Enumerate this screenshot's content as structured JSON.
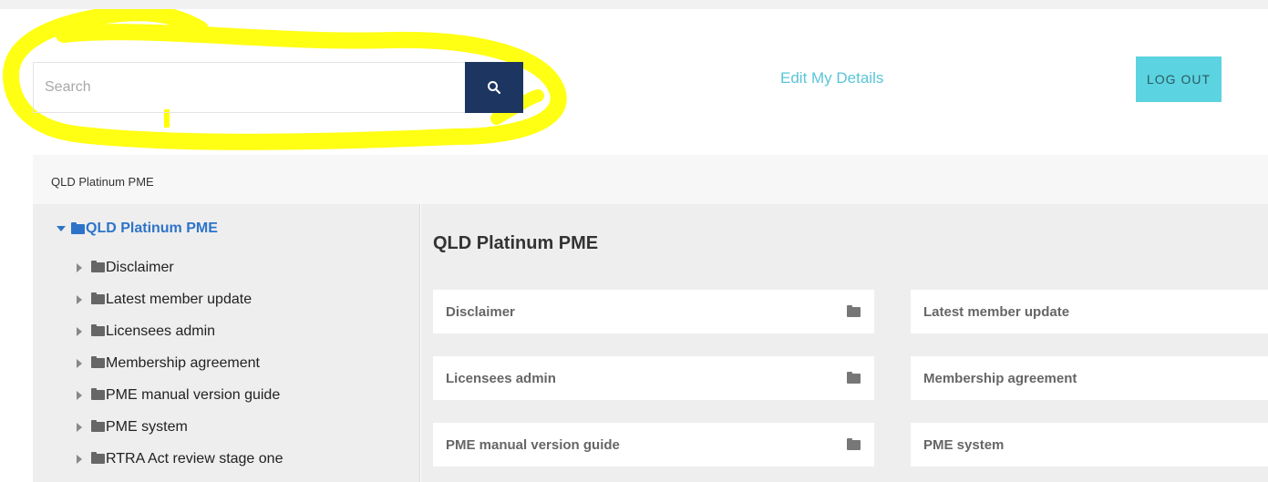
{
  "search": {
    "placeholder": "Search",
    "button_icon": "search-icon"
  },
  "header": {
    "edit_link": "Edit My Details",
    "logout_label": "LOG OUT"
  },
  "breadcrumb": {
    "text": "QLD Platinum PME"
  },
  "sidebar": {
    "root_label": "QLD Platinum PME",
    "items": [
      {
        "label": "Disclaimer"
      },
      {
        "label": "Latest member update"
      },
      {
        "label": "Licensees admin"
      },
      {
        "label": "Membership agreement"
      },
      {
        "label": "PME manual version guide"
      },
      {
        "label": "PME system"
      },
      {
        "label": "RTRA Act review stage one"
      }
    ]
  },
  "main": {
    "title": "QLD Platinum PME",
    "cards": [
      {
        "label": "Disclaimer"
      },
      {
        "label": "Latest member update"
      },
      {
        "label": "Licensees admin"
      },
      {
        "label": "Membership agreement"
      },
      {
        "label": "PME manual version guide"
      },
      {
        "label": "PME system"
      }
    ]
  },
  "colors": {
    "accent": "#5bd3e0",
    "search_button": "#1d3561",
    "link": "#5ac5d8",
    "tree_active": "#2d74c9",
    "highlight": "#ffff00"
  }
}
